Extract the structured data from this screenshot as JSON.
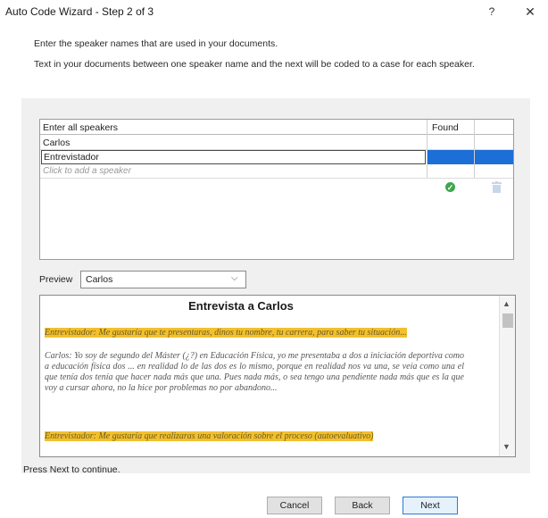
{
  "window": {
    "title": "Auto Code Wizard - Step 2 of 3",
    "help_label": "?",
    "close_label": "✕"
  },
  "intro": {
    "line1": "Enter the speaker names that are used in your documents.",
    "line2": "Text in your documents between one speaker name and the next will be coded to a case for each speaker."
  },
  "grid": {
    "col_speakers": "Enter all speakers",
    "col_found": "Found",
    "rows": [
      {
        "name": "Carlos",
        "found": true,
        "selected": false
      },
      {
        "name": "Entrevistador",
        "found": true,
        "selected": true
      }
    ],
    "add_placeholder": "Click to add a speaker"
  },
  "preview": {
    "label": "Preview",
    "selected": "Carlos",
    "doc_title": "Entrevista a Carlos",
    "para1": "Entrevistador: Me gustaría que te presentaras, dinos tu nombre, tu carrera, para saber tu situación...",
    "para2": "Carlos: Yo soy de segundo del Máster (¿?) en Educación Física, yo me presentaba a dos a iniciación deportiva como a educación física dos ... en realidad lo de las dos es lo mismo, porque en realidad nos va una, se veía como una el que tenía dos tenía que hacer nada más que una. Pues nada más, o sea tengo una pendiente nada más que es la que voy a cursar ahora, no la hice por problemas no por abandono...",
    "para3": "Entrevistador: Me gustaría que realizaras una valoración sobre el proceso (autoevaluativo)"
  },
  "footer": {
    "hint": "Press Next to continue.",
    "cancel": "Cancel",
    "back": "Back",
    "next": "Next"
  },
  "colors": {
    "selection": "#1b6fd6",
    "found_check": "#2e9a3e",
    "highlight": "#f2c02c"
  },
  "icons": {
    "found": "check-circle-icon",
    "delete": "trash-icon"
  }
}
